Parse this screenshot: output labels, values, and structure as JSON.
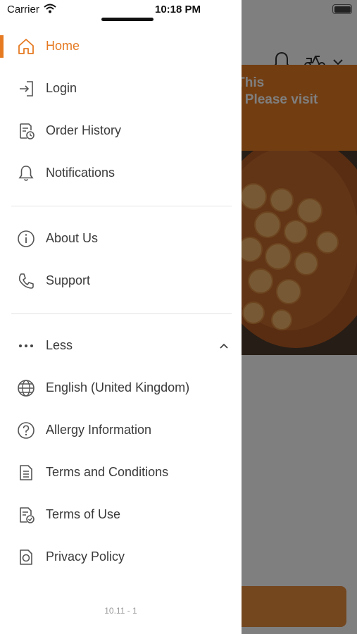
{
  "status_bar": {
    "carrier": "Carrier",
    "time": "10:18 PM"
  },
  "background": {
    "banner_text": "d, This\non. Please visit\n/",
    "accent_color": "#e57a22"
  },
  "menu": {
    "primary": [
      {
        "label": "Home",
        "icon": "home-icon",
        "active": true
      },
      {
        "label": "Login",
        "icon": "login-icon"
      },
      {
        "label": "Order History",
        "icon": "order-history-icon"
      },
      {
        "label": "Notifications",
        "icon": "bell-icon"
      }
    ],
    "secondary": [
      {
        "label": "About Us",
        "icon": "info-icon"
      },
      {
        "label": "Support",
        "icon": "phone-icon"
      }
    ],
    "more": [
      {
        "label": "Less",
        "icon": "more-dots-icon"
      },
      {
        "label": "English (United Kingdom)",
        "icon": "globe-icon"
      },
      {
        "label": "Allergy Information",
        "icon": "question-icon"
      },
      {
        "label": "Terms and Conditions",
        "icon": "document-icon"
      },
      {
        "label": "Terms of Use",
        "icon": "document-check-icon"
      },
      {
        "label": "Privacy Policy",
        "icon": "privacy-icon"
      }
    ]
  },
  "version": "10.11 - 1"
}
